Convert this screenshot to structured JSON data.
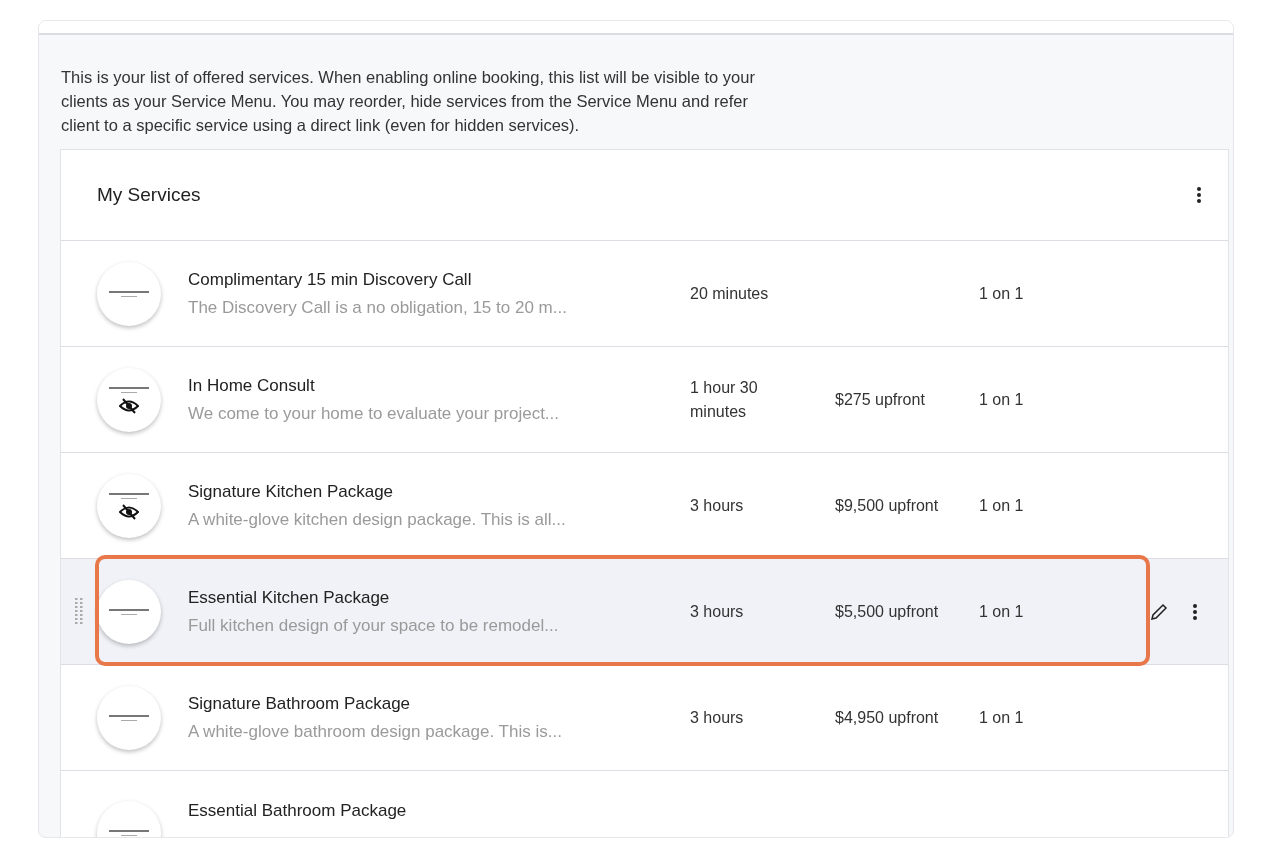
{
  "intro": "This is your list of offered services. When enabling online booking, this list will be visible to your clients as your Service Menu. You may reorder, hide services from the Service Menu and refer client to a specific service using a direct link (even for hidden services).",
  "services_card": {
    "title": "My Services",
    "rows": [
      {
        "name": "Complimentary 15 min Discovery Call",
        "description": "The Discovery Call is a no obligation, 15 to 20 m...",
        "duration": "20 minutes",
        "type": "1 on 1",
        "hidden": false,
        "hovered": false,
        "highlighted": false
      },
      {
        "name": "In Home Consult",
        "description": "We come to your home to evaluate your project...",
        "duration": "1 hour 30 minutes",
        "price": "$275 upfront",
        "type": "1 on 1",
        "hidden": true,
        "hovered": false,
        "highlighted": false
      },
      {
        "name": "Signature Kitchen Package",
        "description": "A white-glove kitchen design package. This is all...",
        "duration": "3 hours",
        "price": "$9,500 upfront",
        "type": "1 on 1",
        "hidden": true,
        "hovered": false,
        "highlighted": false
      },
      {
        "name": "Essential Kitchen Package",
        "description": "Full kitchen design of your space to be remodel...",
        "duration": "3 hours",
        "price": "$5,500 upfront",
        "type": "1 on 1",
        "hidden": false,
        "hovered": true,
        "highlighted": true
      },
      {
        "name": "Signature Bathroom Package",
        "description": "A white-glove bathroom design package. This is...",
        "duration": "3 hours",
        "price": "$4,950 upfront",
        "type": "1 on 1",
        "hidden": false,
        "hovered": false,
        "highlighted": false
      },
      {
        "name": "Essential Bathroom Package",
        "hidden": false,
        "hovered": false,
        "highlighted": false
      }
    ]
  }
}
